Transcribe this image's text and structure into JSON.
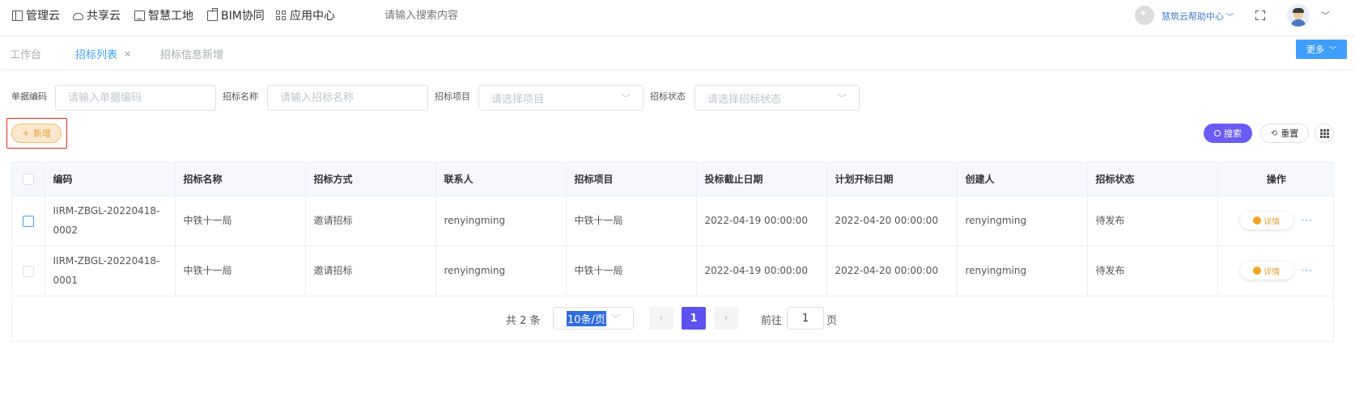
{
  "topnav": {
    "items": [
      {
        "label": "管理云",
        "icon": "book-icon"
      },
      {
        "label": "共享云",
        "icon": "cloud-icon"
      },
      {
        "label": "智慧工地",
        "icon": "site-icon"
      },
      {
        "label": "BIM协同",
        "icon": "bim-icon"
      },
      {
        "label": "应用中心",
        "icon": "grid-icon"
      }
    ],
    "search_placeholder": "请输入搜索内容",
    "help_label": "慧筑云帮助中心"
  },
  "tabs": [
    {
      "label": "工作台",
      "active": false
    },
    {
      "label": "招标列表",
      "active": true,
      "closable": true
    },
    {
      "label": "招标信息新增",
      "active": false
    }
  ],
  "more_button": "更多",
  "filters": {
    "code_label": "单据编码",
    "code_placeholder": "请输入单据编码",
    "name_label": "招标名称",
    "name_placeholder": "请输入招标名称",
    "project_label": "招标项目",
    "project_placeholder": "请选择项目",
    "status_label": "招标状态",
    "status_placeholder": "请选择招标状态"
  },
  "actions": {
    "add": "新增",
    "search": "搜索",
    "reset": "重置"
  },
  "table": {
    "columns": [
      "编码",
      "招标名称",
      "招标方式",
      "联系人",
      "招标项目",
      "投标截止日期",
      "计划开标日期",
      "创建人",
      "招标状态",
      "操作"
    ],
    "rows": [
      {
        "code": "IIRM-ZBGL-20220418-0002",
        "name": "中铁十一局",
        "method": "邀请招标",
        "contact": "renyingming",
        "project": "中铁十一局",
        "deadline": "2022-04-19 00:00:00",
        "open_date": "2022-04-20 00:00:00",
        "creator": "renyingming",
        "status": "待发布",
        "action": "详情"
      },
      {
        "code": "IIRM-ZBGL-20220418-0001",
        "name": "中铁十一局",
        "method": "邀请招标",
        "contact": "renyingming",
        "project": "中铁十一局",
        "deadline": "2022-04-19 00:00:00",
        "open_date": "2022-04-20 00:00:00",
        "creator": "renyingming",
        "status": "待发布",
        "action": "详情"
      }
    ]
  },
  "pagination": {
    "total": "共 2 条",
    "page_size": "10条/页",
    "current_page": "1",
    "goto_label": "前往",
    "goto_value": "1",
    "unit": "页"
  },
  "colors": {
    "primary": "#409eff",
    "search_button": "#6a5cf5",
    "current_page": "#5b52f0",
    "add_button_bg": "#fde8cf",
    "highlight_outline": "#e5261e"
  }
}
